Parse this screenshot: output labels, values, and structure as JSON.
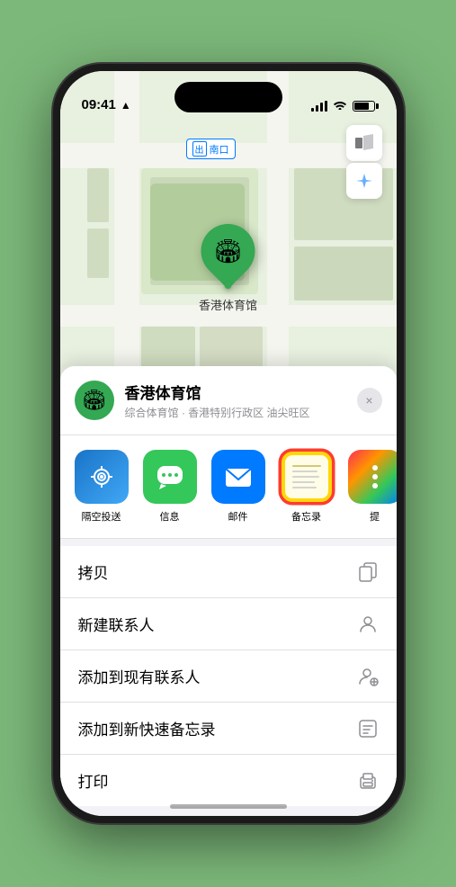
{
  "status_bar": {
    "time": "09:41",
    "location_arrow": "▶"
  },
  "map": {
    "label_text": "南口",
    "label_prefix": "出",
    "pin_emoji": "🏟",
    "pin_label": "香港体育馆",
    "controls": {
      "map_icon": "🗺",
      "location_icon": "➤"
    }
  },
  "location_card": {
    "name": "香港体育馆",
    "subtitle": "综合体育馆 · 香港特别行政区 油尖旺区",
    "close_label": "×"
  },
  "share_items": [
    {
      "id": "airdrop",
      "label": "隔空投送",
      "icon": "📡"
    },
    {
      "id": "messages",
      "label": "信息",
      "icon": "💬"
    },
    {
      "id": "mail",
      "label": "邮件",
      "icon": "✉"
    },
    {
      "id": "notes",
      "label": "备忘录",
      "icon": "notes"
    },
    {
      "id": "more",
      "label": "提",
      "icon": "more"
    }
  ],
  "action_items": [
    {
      "id": "copy",
      "label": "拷贝",
      "icon": "⎘"
    },
    {
      "id": "new-contact",
      "label": "新建联系人",
      "icon": "👤"
    },
    {
      "id": "add-existing",
      "label": "添加到现有联系人",
      "icon": "👤"
    },
    {
      "id": "add-notes",
      "label": "添加到新快速备忘录",
      "icon": "📝"
    },
    {
      "id": "print",
      "label": "打印",
      "icon": "🖨"
    }
  ]
}
